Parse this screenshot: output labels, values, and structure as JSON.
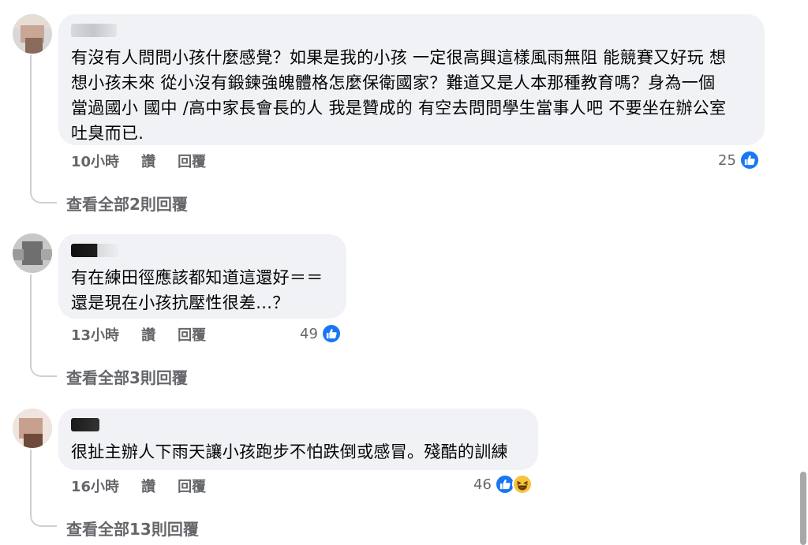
{
  "comments": [
    {
      "text": "有沒有人問問小孩什麼感覺？如果是我的小孩 一定很高興這樣風雨無阻 能競賽又好玩 想\n想小孩未來 從小沒有鍛鍊強魄體格怎麼保衛國家？難道又是人本那種教育嗎？身為一個\n當過國小 國中 /高中家長會長的人 我是贊成的 有空去問問學生當事人吧 不要坐在辦公室\n吐臭而已.",
      "time": "10小時",
      "like": "讚",
      "reply": "回覆",
      "reaction_count": "25",
      "reactions": [
        "like-icon"
      ],
      "view_replies": "查看全部2則回覆"
    },
    {
      "text": "有在練田徑應該都知道這還好＝＝\n還是現在小孩抗壓性很差...？",
      "time": "13小時",
      "like": "讚",
      "reply": "回覆",
      "reaction_count": "49",
      "reactions": [
        "like-icon"
      ],
      "view_replies": "查看全部3則回覆"
    },
    {
      "text": "很扯主辦人下雨天讓小孩跑步不怕跌倒或感冒。殘酷的訓練",
      "time": "16小時",
      "like": "讚",
      "reply": "回覆",
      "reaction_count": "46",
      "reactions": [
        "like-icon",
        "haha-icon"
      ],
      "view_replies": "查看全部13則回覆"
    }
  ],
  "colors": {
    "bubble": "#f0f2f5",
    "like_blue": "#1877f2",
    "haha_yellow": "#f7c33d",
    "meta_text": "#65676b"
  }
}
